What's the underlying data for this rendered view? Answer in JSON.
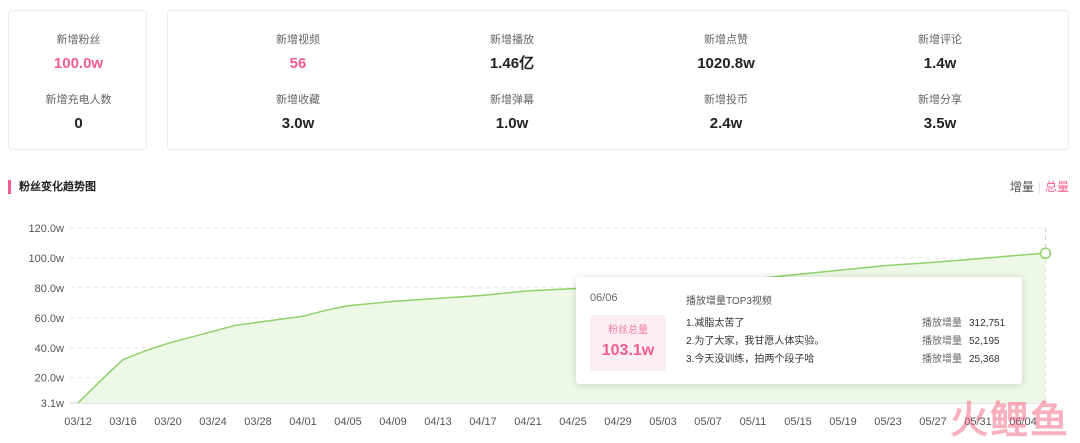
{
  "stats_left": [
    {
      "label": "新增粉丝",
      "value": "100.0w",
      "highlight": true
    },
    {
      "label": "新增充电人数",
      "value": "0",
      "highlight": false
    }
  ],
  "stats_right": [
    {
      "label": "新增视频",
      "value": "56",
      "highlight": true
    },
    {
      "label": "新增播放",
      "value": "1.46亿",
      "highlight": false
    },
    {
      "label": "新增点赞",
      "value": "1020.8w",
      "highlight": false
    },
    {
      "label": "新增评论",
      "value": "1.4w",
      "highlight": false
    },
    {
      "label": "新增收藏",
      "value": "3.0w",
      "highlight": false
    },
    {
      "label": "新增弹幕",
      "value": "1.0w",
      "highlight": false
    },
    {
      "label": "新增投币",
      "value": "2.4w",
      "highlight": false
    },
    {
      "label": "新增分享",
      "value": "3.5w",
      "highlight": false
    }
  ],
  "section": {
    "title": "粉丝变化趋势图"
  },
  "toggle": {
    "increment": "增量",
    "total": "总量",
    "active": "total"
  },
  "tooltip": {
    "date": "06/06",
    "fans_label": "粉丝总量",
    "fans_value": "103.1w",
    "top_title": "播放增量TOP3视频",
    "videos": [
      {
        "title": "1.减脂太苦了",
        "metric_label": "播放增量",
        "metric_value": "312,751"
      },
      {
        "title": "2.为了大家，我甘愿人体实验。",
        "metric_label": "播放增量",
        "metric_value": "52,195"
      },
      {
        "title": "3.今天没训练，拍两个段子哈",
        "metric_label": "播放增量",
        "metric_value": "25,368"
      }
    ]
  },
  "watermark": "火鲤鱼",
  "colors": {
    "accent": "#f25d8e",
    "line": "#8fd16a",
    "area": "#eef8e6"
  },
  "chart_data": {
    "type": "area",
    "title": "粉丝变化趋势图",
    "xlabel": "",
    "ylabel": "",
    "y_tick_labels": [
      "3.1w",
      "20.0w",
      "40.0w",
      "60.0w",
      "80.0w",
      "100.0w",
      "120.0w"
    ],
    "y_ticks": [
      3.1,
      20,
      40,
      60,
      80,
      100,
      120
    ],
    "ylim": [
      3.1,
      120
    ],
    "grid": true,
    "x_tick_labels": [
      "03/12",
      "03/16",
      "03/20",
      "03/24",
      "03/28",
      "04/01",
      "04/05",
      "04/09",
      "04/13",
      "04/17",
      "04/21",
      "04/25",
      "04/29",
      "05/03",
      "05/07",
      "05/11",
      "05/15",
      "05/19",
      "05/23",
      "05/27",
      "05/31",
      "06/04"
    ],
    "series": [
      {
        "name": "粉丝总量",
        "x": [
          "03/12",
          "03/14",
          "03/16",
          "03/18",
          "03/20",
          "03/22",
          "03/24",
          "03/26",
          "03/28",
          "03/30",
          "04/01",
          "04/03",
          "04/05",
          "04/09",
          "04/13",
          "04/17",
          "04/21",
          "04/25",
          "04/29",
          "05/03",
          "05/07",
          "05/11",
          "05/15",
          "05/19",
          "05/23",
          "05/27",
          "05/31",
          "06/04",
          "06/06"
        ],
        "y": [
          3.1,
          18,
          32,
          38,
          43,
          47,
          51,
          55,
          57,
          59,
          61,
          65,
          68,
          71,
          73,
          75,
          78,
          79.5,
          81,
          82.5,
          84,
          86,
          89,
          92,
          95,
          97,
          99.5,
          102,
          103.1
        ]
      }
    ],
    "highlight_point": {
      "x": "06/06",
      "y": 103.1
    }
  }
}
